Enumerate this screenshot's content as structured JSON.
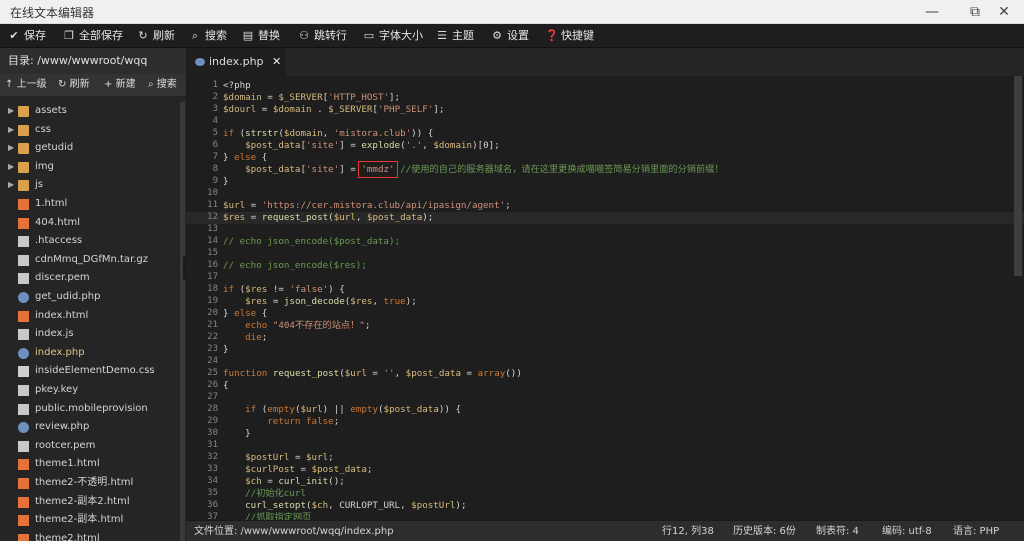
{
  "window": {
    "title": "在线文本编辑器",
    "minimize_icon": "—",
    "maximize_icon": "⧉",
    "close_icon": "✕"
  },
  "toolbar": {
    "items": [
      {
        "label": "保存",
        "icon": "✔"
      },
      {
        "label": "全部保存",
        "icon": "❐"
      },
      {
        "label": "刷新",
        "icon": "↻"
      },
      {
        "label": "搜索",
        "icon": "⌕"
      },
      {
        "label": "替换",
        "icon": "▤"
      },
      {
        "label": "跳转行",
        "icon": "⚇"
      },
      {
        "label": "字体大小",
        "icon": "▭"
      },
      {
        "label": "主题",
        "icon": "☰"
      },
      {
        "label": "设置",
        "icon": "⚙"
      },
      {
        "label": "快捷键",
        "icon": "❓"
      }
    ]
  },
  "sidebar": {
    "path_label": "目录: /www/wwwroot/wqq",
    "actions": [
      {
        "label": "上一级",
        "icon": "↑"
      },
      {
        "label": "刷新",
        "icon": "↻"
      },
      {
        "label": "新建",
        "icon": "+"
      },
      {
        "label": "搜索",
        "icon": "⌕"
      }
    ],
    "collapse_icon": "‹",
    "files": [
      {
        "name": "assets",
        "type": "folder"
      },
      {
        "name": "css",
        "type": "folder"
      },
      {
        "name": "getudid",
        "type": "folder"
      },
      {
        "name": "img",
        "type": "folder"
      },
      {
        "name": "js",
        "type": "folder"
      },
      {
        "name": "1.html",
        "type": "html"
      },
      {
        "name": "404.html",
        "type": "html"
      },
      {
        "name": ".htaccess",
        "type": "doc"
      },
      {
        "name": "cdnMmq_DGfMn.tar.gz",
        "type": "doc"
      },
      {
        "name": "discer.pem",
        "type": "doc"
      },
      {
        "name": "get_udid.php",
        "type": "php"
      },
      {
        "name": "index.html",
        "type": "html"
      },
      {
        "name": "index.js",
        "type": "doc"
      },
      {
        "name": "index.php",
        "type": "php",
        "active": true
      },
      {
        "name": "insideElementDemo.css",
        "type": "css"
      },
      {
        "name": "pkey.key",
        "type": "doc"
      },
      {
        "name": "public.mobileprovision",
        "type": "doc"
      },
      {
        "name": "review.php",
        "type": "php"
      },
      {
        "name": "rootcer.pem",
        "type": "doc"
      },
      {
        "name": "theme1.html",
        "type": "html"
      },
      {
        "name": "theme2-不透明.html",
        "type": "html"
      },
      {
        "name": "theme2-副本2.html",
        "type": "html"
      },
      {
        "name": "theme2-副本.html",
        "type": "html"
      },
      {
        "name": "theme2.html",
        "type": "html"
      }
    ]
  },
  "tab": {
    "name": "index.php",
    "close_icon": "✕"
  },
  "editor": {
    "current_line": 12,
    "highlight_line": 8,
    "lines": [
      "<?php",
      "$domain = $_SERVER['HTTP_HOST'];",
      "$dourl = $domain . $_SERVER['PHP_SELF'];",
      "",
      "if (strstr($domain, 'mistora.club')) {",
      "    $post_data['site'] = explode('.', $domain)[0];",
      "} else {",
      "    $post_data['site'] = 'mmdz' //使用的自己的服务器域名，请在这里更换成喵喵签简易分销里面的分销前缀！",
      "}",
      "",
      "$url = 'https://cer.mistora.club/api/ipasign/agent';",
      "$res = request_post($url, $post_data);",
      "",
      "// echo json_encode($post_data);",
      "",
      "// echo json_encode($res);",
      "",
      "if ($res != 'false') {",
      "    $res = json_decode($res, true);",
      "} else {",
      "    echo \"404不存在的站点！\";",
      "    die;",
      "}",
      "",
      "function request_post($url = '', $post_data = array())",
      "{",
      "",
      "    if (empty($url) || empty($post_data)) {",
      "        return false;",
      "    }",
      "",
      "    $postUrl = $url;",
      "    $curlPost = $post_data;",
      "    $ch = curl_init();",
      "    //初始化curl",
      "    curl_setopt($ch, CURLOPT_URL, $postUrl);",
      "    //抓取指定网页"
    ]
  },
  "status": {
    "file_location": "文件位置: /www/wwwroot/wqq/index.php",
    "cursor": "行12, 列38",
    "history": "历史版本: 6份",
    "tabs": "制表符: 4",
    "encoding": "编码: utf-8",
    "language": "语言: PHP"
  },
  "colors": {
    "keyword": "#cc7832",
    "variable": "#d7ba7d",
    "string": "#ce9178",
    "comment": "#6a9955",
    "function": "#dcdcaa",
    "highlight_box": "#e53935"
  }
}
